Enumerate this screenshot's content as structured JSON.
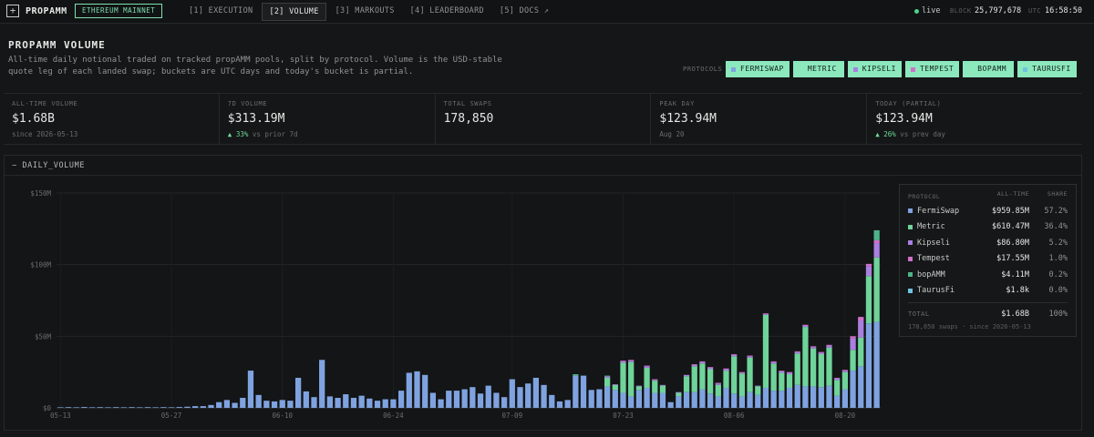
{
  "app": {
    "logo_glyph": "+",
    "name": "PROPAMM",
    "network": "ETHEREUM MAINNET"
  },
  "nav": [
    {
      "label": "[1] EXECUTION"
    },
    {
      "label": "[2] VOLUME",
      "active": true
    },
    {
      "label": "[3] MARKOUTS"
    },
    {
      "label": "[4] LEADERBOARD"
    },
    {
      "label": "[5] DOCS ↗"
    }
  ],
  "status": {
    "live": "live",
    "block_label": "BLOCK",
    "block": "25,797,678",
    "utc_label": "UTC",
    "time": "16:58:50"
  },
  "header": {
    "title": "PROPAMM VOLUME",
    "description": "All-time daily notional traded on tracked propAMM pools, split by protocol. Volume is the USD-stable quote leg of each landed swap; buckets are UTC days and today's bucket is partial.",
    "protocols_label": "PROTOCOLS"
  },
  "protocol_chips": [
    {
      "label": "FERMISWAP",
      "color": "#7fa3e0"
    },
    {
      "label": "METRIC",
      "color": "#6fd39a"
    },
    {
      "label": "KIPSELI",
      "color": "#a980e0"
    },
    {
      "label": "TEMPEST",
      "color": "#d070c9"
    },
    {
      "label": "BOPAMM",
      "color": "#4fb38a"
    },
    {
      "label": "TAURUSFI",
      "color": "#6fc3e0"
    }
  ],
  "stats": [
    {
      "label": "ALL-TIME VOLUME",
      "value": "$1.68B",
      "sub": "since 2026-05-13"
    },
    {
      "label": "7D VOLUME",
      "value": "$313.19M",
      "delta": "▲ 33%",
      "sub": " vs prior 7d"
    },
    {
      "label": "TOTAL SWAPS",
      "value": "178,850",
      "sub": ""
    },
    {
      "label": "PEAK DAY",
      "value": "$123.94M",
      "sub": "Aug 20"
    },
    {
      "label": "TODAY (PARTIAL)",
      "value": "$123.94M",
      "delta": "▲ 26%",
      "sub": " vs prev day"
    }
  ],
  "panel": {
    "title": "− DAILY_VOLUME"
  },
  "legend": {
    "headers": {
      "protocol": "PROTOCOL",
      "all_time": "ALL-TIME",
      "share": "SHARE"
    },
    "rows": [
      {
        "name": "FermiSwap",
        "value": "$959.85M",
        "share": "57.2%",
        "color": "#7fa3e0"
      },
      {
        "name": "Metric",
        "value": "$610.47M",
        "share": "36.4%",
        "color": "#6fd39a"
      },
      {
        "name": "Kipseli",
        "value": "$86.80M",
        "share": "5.2%",
        "color": "#a980e0"
      },
      {
        "name": "Tempest",
        "value": "$17.55M",
        "share": "1.0%",
        "color": "#d070c9"
      },
      {
        "name": "bopAMM",
        "value": "$4.11M",
        "share": "0.2%",
        "color": "#4fb38a"
      },
      {
        "name": "TaurusFi",
        "value": "$1.8k",
        "share": "0.0%",
        "color": "#6fc3e0"
      }
    ],
    "total": {
      "label": "TOTAL",
      "value": "$1.68B",
      "share": "100%"
    },
    "footer": "178,850 swaps · since 2026-05-13"
  },
  "chart_data": {
    "type": "bar",
    "stacked": true,
    "title": "DAILY_VOLUME",
    "x_tick_labels": [
      "05-13",
      "05-27",
      "06-10",
      "06-24",
      "07-09",
      "07-23",
      "08-06",
      "08-20"
    ],
    "x_tick_index": [
      0,
      14,
      28,
      42,
      57,
      71,
      85,
      99
    ],
    "y_tick_labels": [
      "$0",
      "$50M",
      "$100M",
      "$150M"
    ],
    "ylim": [
      0,
      150
    ],
    "y_unit": "$M",
    "grid": true,
    "legend_position": "right",
    "series_names": [
      "FermiSwap",
      "Metric",
      "Kipseli",
      "Tempest",
      "bopAMM"
    ],
    "series_colors": [
      "#7fa3e0",
      "#6fd39a",
      "#a980e0",
      "#d070c9",
      "#4fb38a"
    ],
    "days": [
      [
        0.4,
        0,
        0,
        0,
        0
      ],
      [
        0.5,
        0,
        0,
        0,
        0
      ],
      [
        0.4,
        0,
        0,
        0,
        0
      ],
      [
        0.6,
        0,
        0,
        0,
        0
      ],
      [
        0.4,
        0,
        0,
        0,
        0
      ],
      [
        0.5,
        0,
        0,
        0,
        0
      ],
      [
        0.4,
        0,
        0,
        0,
        0
      ],
      [
        0.5,
        0,
        0,
        0,
        0
      ],
      [
        0.4,
        0,
        0,
        0,
        0
      ],
      [
        0.5,
        0,
        0,
        0,
        0
      ],
      [
        0.4,
        0,
        0,
        0,
        0
      ],
      [
        0.5,
        0,
        0,
        0,
        0
      ],
      [
        0.4,
        0,
        0,
        0,
        0
      ],
      [
        0.5,
        0,
        0,
        0,
        0
      ],
      [
        0.4,
        0,
        0,
        0,
        0
      ],
      [
        0.6,
        0,
        0,
        0,
        0
      ],
      [
        0.8,
        0,
        0,
        0,
        0
      ],
      [
        1.2,
        0,
        0,
        0,
        0
      ],
      [
        1.2,
        0,
        0,
        0,
        0
      ],
      [
        2.0,
        0,
        0,
        0,
        0
      ],
      [
        4.0,
        0,
        0,
        0,
        0
      ],
      [
        5.5,
        0,
        0,
        0,
        0
      ],
      [
        3.5,
        0,
        0,
        0,
        0
      ],
      [
        7.0,
        0,
        0,
        0,
        0
      ],
      [
        26.0,
        0,
        0,
        0,
        0
      ],
      [
        9.0,
        0,
        0,
        0,
        0
      ],
      [
        5.0,
        0,
        0,
        0,
        0
      ],
      [
        4.5,
        0,
        0,
        0,
        0
      ],
      [
        5.5,
        0,
        0,
        0,
        0
      ],
      [
        5.0,
        0,
        0,
        0,
        0
      ],
      [
        21.0,
        0,
        0,
        0,
        0
      ],
      [
        11.5,
        0,
        0,
        0,
        0
      ],
      [
        7.5,
        0,
        0,
        0,
        0
      ],
      [
        33.5,
        0,
        0,
        0,
        0
      ],
      [
        8.0,
        0,
        0,
        0,
        0
      ],
      [
        7.0,
        0,
        0,
        0,
        0
      ],
      [
        9.5,
        0,
        0,
        0,
        0
      ],
      [
        7.0,
        0,
        0,
        0,
        0
      ],
      [
        8.5,
        0,
        0,
        0,
        0
      ],
      [
        6.5,
        0,
        0,
        0,
        0
      ],
      [
        5.0,
        0,
        0,
        0,
        0
      ],
      [
        6.0,
        0,
        0,
        0,
        0
      ],
      [
        6.0,
        0,
        0,
        0,
        0
      ],
      [
        12.0,
        0,
        0,
        0,
        0
      ],
      [
        24.5,
        0,
        0,
        0,
        0
      ],
      [
        25.5,
        0,
        0,
        0,
        0
      ],
      [
        23.0,
        0,
        0,
        0,
        0
      ],
      [
        10.5,
        0,
        0,
        0,
        0
      ],
      [
        6.0,
        0,
        0,
        0,
        0
      ],
      [
        12.0,
        0,
        0,
        0,
        0
      ],
      [
        12.0,
        0,
        0,
        0,
        0
      ],
      [
        13.0,
        0,
        0,
        0,
        0
      ],
      [
        14.5,
        0,
        0,
        0,
        0
      ],
      [
        10.0,
        0,
        0,
        0,
        0
      ],
      [
        15.5,
        0,
        0,
        0,
        0
      ],
      [
        10.5,
        0,
        0,
        0,
        0
      ],
      [
        7.5,
        0,
        0,
        0,
        0
      ],
      [
        20.0,
        0,
        0,
        0,
        0
      ],
      [
        14.5,
        0,
        0,
        0,
        0
      ],
      [
        17.0,
        0,
        0,
        0,
        0
      ],
      [
        21.0,
        0,
        0,
        0,
        0
      ],
      [
        16.0,
        0,
        0,
        0,
        0
      ],
      [
        9.0,
        0,
        0,
        0,
        0
      ],
      [
        4.5,
        0,
        0,
        0,
        0
      ],
      [
        5.5,
        0,
        0,
        0,
        0
      ],
      [
        22.5,
        0,
        0,
        0,
        1
      ],
      [
        22.5,
        0,
        0,
        0,
        0
      ],
      [
        12.5,
        0,
        0,
        0,
        0
      ],
      [
        13.0,
        0,
        0,
        0,
        0
      ],
      [
        15.0,
        6.0,
        1.0,
        0,
        0.5
      ],
      [
        12.5,
        3.5,
        0.5,
        0,
        0
      ],
      [
        10.5,
        21.0,
        1.0,
        0.5,
        0
      ],
      [
        8.0,
        24.0,
        1.0,
        0.5,
        0
      ],
      [
        12.5,
        2.5,
        0.5,
        0,
        0
      ],
      [
        14.0,
        14.0,
        1.0,
        0.5,
        0
      ],
      [
        10.5,
        8.5,
        0.5,
        0.5,
        0
      ],
      [
        10.5,
        5.0,
        0.5,
        0,
        0
      ],
      [
        4.0,
        0,
        0,
        0,
        0
      ],
      [
        8.0,
        2.5,
        0.5,
        0,
        0
      ],
      [
        11.0,
        11.0,
        1.0,
        0,
        0
      ],
      [
        11.0,
        18.0,
        1.0,
        0.5,
        0
      ],
      [
        13.0,
        18.0,
        1.0,
        0.5,
        0
      ],
      [
        10.0,
        17.0,
        1.0,
        0.5,
        0
      ],
      [
        8.0,
        8.0,
        1.0,
        0.5,
        0
      ],
      [
        14.0,
        12.0,
        1.0,
        0.5,
        0
      ],
      [
        10.0,
        26.0,
        1.0,
        0.5,
        0
      ],
      [
        8.0,
        16.0,
        0.5,
        0.5,
        0
      ],
      [
        11.0,
        24.0,
        1.0,
        0.5,
        0
      ],
      [
        9.0,
        6.0,
        0.5,
        0,
        0
      ],
      [
        14.0,
        51.0,
        0.5,
        0.5,
        0
      ],
      [
        12.0,
        19.0,
        1.0,
        0.5,
        0
      ],
      [
        12.0,
        12.5,
        1.0,
        0.5,
        0
      ],
      [
        14.0,
        9.5,
        1.0,
        0.5,
        0
      ],
      [
        16.0,
        22.0,
        1.0,
        0.5,
        0
      ],
      [
        15.0,
        41.5,
        1.0,
        0.5,
        0
      ],
      [
        15.0,
        26.5,
        1.0,
        0.5,
        0
      ],
      [
        14.5,
        23.0,
        1.0,
        0.5,
        0
      ],
      [
        15.5,
        26.5,
        1.5,
        0.5,
        0
      ],
      [
        8.5,
        11.0,
        1.0,
        0.5,
        0
      ],
      [
        13.0,
        12.0,
        1.0,
        0.5,
        0
      ],
      [
        26.0,
        14.5,
        8.0,
        1.5,
        0
      ],
      [
        29.0,
        20.0,
        12.0,
        2.5,
        0
      ],
      [
        59.0,
        33.0,
        7.0,
        1.5,
        0
      ],
      [
        60.0,
        45.0,
        10.0,
        2.0,
        7.0
      ]
    ]
  }
}
